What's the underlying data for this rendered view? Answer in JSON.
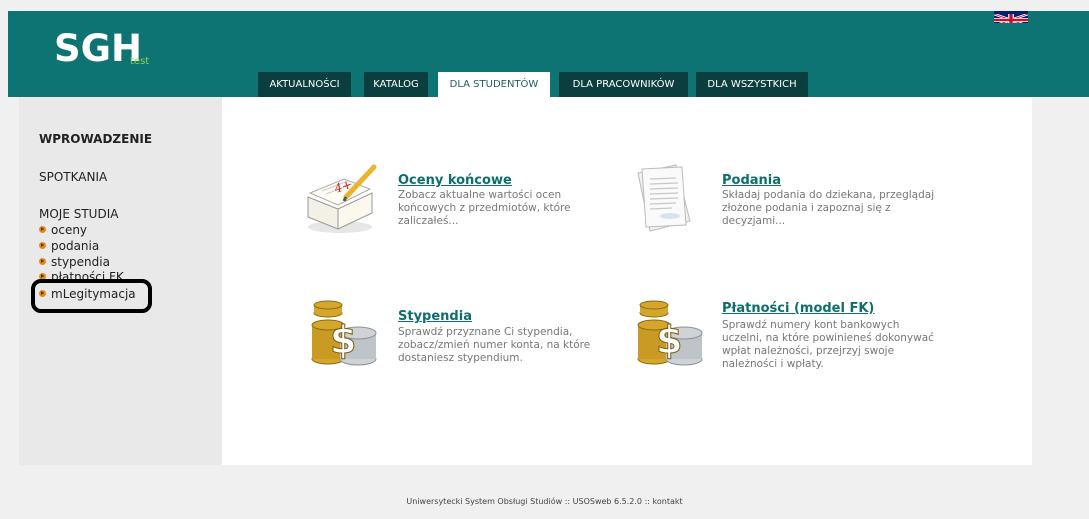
{
  "header": {
    "logo": "SGH",
    "logo_sub": "test",
    "language_flag_icon": "uk-flag-icon",
    "colors": {
      "header_bg": "#0e7373",
      "tab_bg": "#0b3f3f",
      "logo_sub": "#8fd14f"
    }
  },
  "tabs": [
    {
      "label": "AKTUALNOŚCI"
    },
    {
      "label": "KATALOG"
    },
    {
      "label": "DLA STUDENTÓW",
      "active": true
    },
    {
      "label": "DLA PRACOWNIKÓW"
    },
    {
      "label": "DLA WSZYSTKICH"
    }
  ],
  "sidebar": {
    "intro": "WPROWADZENIE",
    "meetings": "SPOTKANIA",
    "my_studies": "MOJE STUDIA",
    "links": [
      "oceny",
      "podania",
      "stypendia",
      "płatności FK",
      "mLegitymacja"
    ]
  },
  "tiles": [
    {
      "title": "Oceny końcowe",
      "desc": "Zobacz aktualne wartości ocen końcowych z przedmiotów, które zaliczałeś...",
      "icon": "gradebook-icon"
    },
    {
      "title": "Podania",
      "desc": "Składaj podania do dziekana, przeglądaj złożone podania i zapoznaj się z decyzjami...",
      "icon": "documents-icon"
    },
    {
      "title": "Stypendia",
      "desc": "Sprawdź przyznane Ci stypendia, zobacz/zmień numer konta, na które dostaniesz stypendium.",
      "icon": "coins-icon"
    },
    {
      "title": "Płatności (model FK)",
      "desc": "Sprawdź numery kont bankowych uczelni, na które powinieneś dokonywać wpłat należności, przejrzyj swoje należności i wpłaty.",
      "icon": "coins-icon"
    }
  ],
  "footer": "Uniwersytecki System Obsługi Studiów :: USOSweb 6.5.2.0 :: kontakt"
}
